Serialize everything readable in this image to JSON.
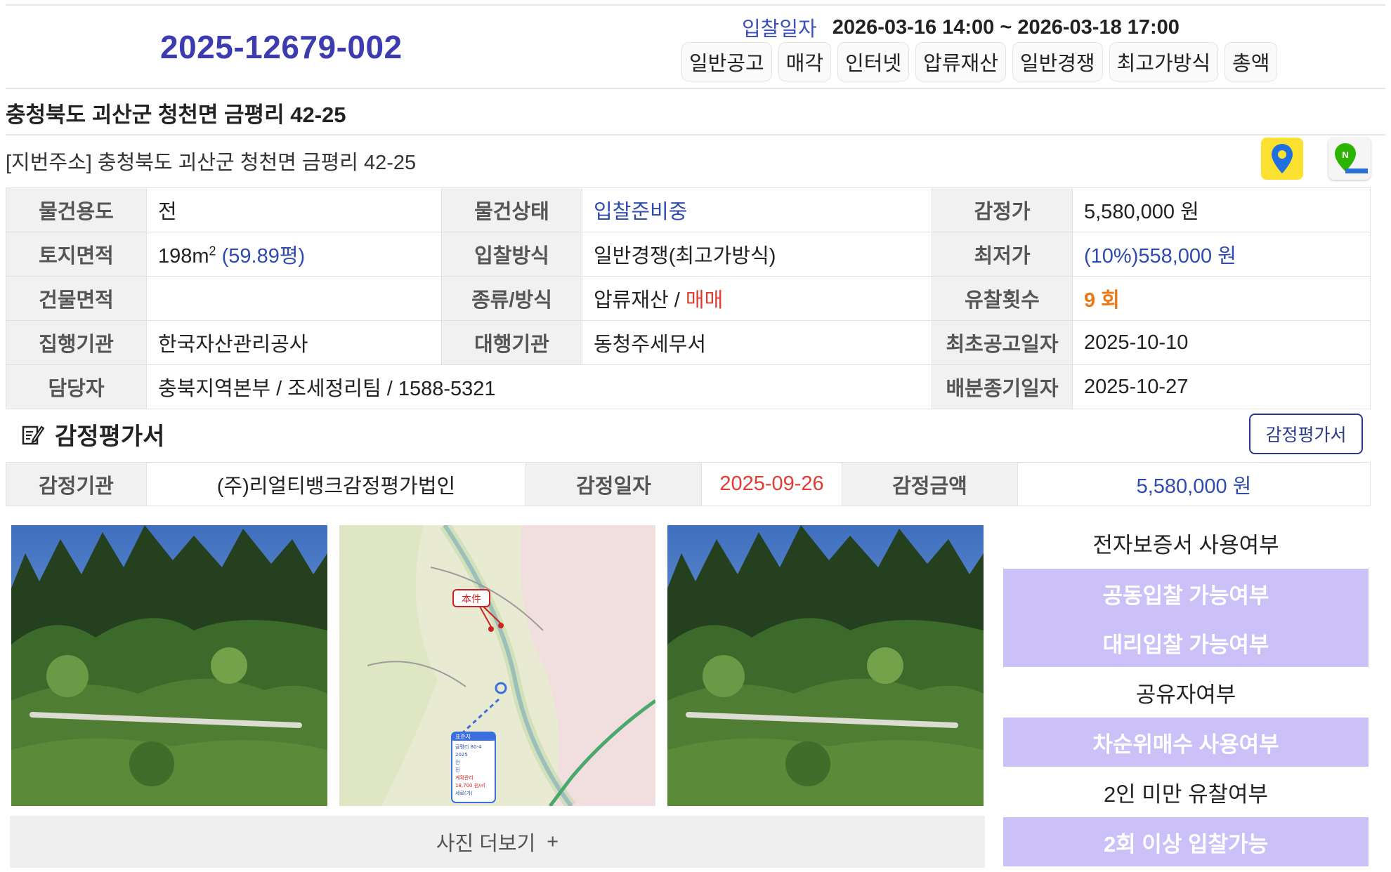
{
  "header": {
    "case_no": "2025-12679-002",
    "bid_date_label": "입찰일자",
    "bid_date_value": "2026-03-16 14:00 ~ 2026-03-18 17:00",
    "tags": [
      "일반공고",
      "매각",
      "인터넷",
      "압류재산",
      "일반경쟁",
      "최고가방식",
      "총액"
    ]
  },
  "address": {
    "main": "충청북도 괴산군 청천면 금평리 42-25",
    "jibun": "[지번주소] 충청북도 괴산군 청천면 금평리 42-25",
    "kakao_map_icon": "map-pin-icon",
    "naver_map_icon": "naver-map-icon"
  },
  "info": {
    "usage_label": "물건용도",
    "usage": "전",
    "status_label": "물건상태",
    "status": "입찰준비중",
    "appraisal_label": "감정가",
    "appraisal": "5,580,000 원",
    "land_label": "토지면적",
    "land_area": "198m",
    "land_sup": "2",
    "land_pyeong": "(59.89평)",
    "bid_method_label": "입찰방식",
    "bid_method": "일반경쟁(최고가방식)",
    "min_price_label": "최저가",
    "min_price": "(10%)558,000 원",
    "building_label": "건물면적",
    "building_area": "",
    "kind_label": "종류/방식",
    "kind": "압류재산 / ",
    "kind_sale": "매매",
    "fail_label": "유찰횟수",
    "fail_count": "9 회",
    "executor_label": "집행기관",
    "executor": "한국자산관리공사",
    "agent_label": "대행기관",
    "agent": "동청주세무서",
    "first_notice_label": "최초공고일자",
    "first_notice": "2025-10-10",
    "contact_label": "담당자",
    "contact": "충북지역본부 / 조세정리팀 / 1588-5321",
    "dist_label": "배분종기일자",
    "dist_date": "2025-10-27"
  },
  "appraisal": {
    "title": "감정평가서",
    "button": "감정평가서",
    "org_label": "감정기관",
    "org": "(주)리얼티뱅크감정평가법인",
    "date_label": "감정일자",
    "date": "2025-09-26",
    "amount_label": "감정금액",
    "amount": "5,580,000 원"
  },
  "photos": {
    "more_label": "사진 더보기",
    "more_icon": "+",
    "map_tag": "本件",
    "map_popup_title": "표준지",
    "map_popup_lines": [
      "금평리 80-4",
      "2025",
      "전",
      "전",
      "계획관리",
      "18,700 원/㎡",
      "세로(가)"
    ]
  },
  "options": {
    "e_guarantee": "전자보증서 사용여부",
    "joint_bid": "공동입찰 가능여부",
    "proxy_bid": "대리입찰 가능여부",
    "co_owner": "공유자여부",
    "next_rank": "차순위매수 사용여부",
    "under_two": "2인 미만 유찰여부",
    "two_plus": "2회 이상 입찰가능"
  }
}
